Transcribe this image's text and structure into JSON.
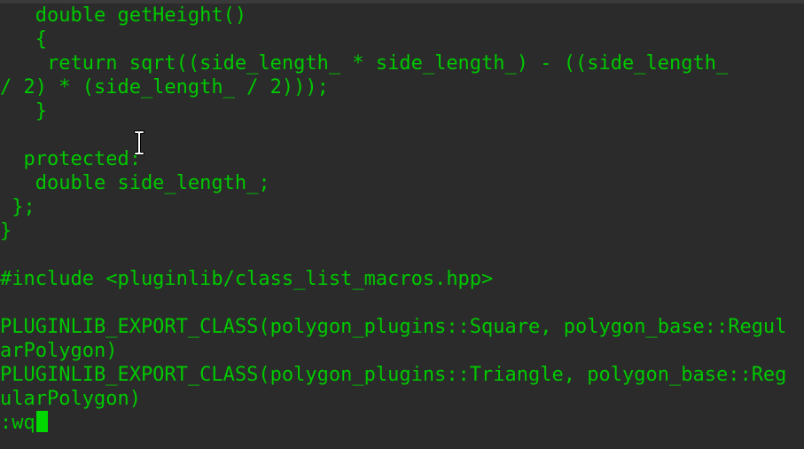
{
  "editor": {
    "lines": [
      "   double getHeight()",
      "   {",
      "    return sqrt((side_length_ * side_length_) - ((side_length_",
      "/ 2) * (side_length_ / 2)));",
      "   }",
      "",
      "  protected:",
      "   double side_length_;",
      " };",
      "}",
      "",
      "#include <pluginlib/class_list_macros.hpp>",
      "",
      "PLUGINLIB_EXPORT_CLASS(polygon_plugins::Square, polygon_base::Regul",
      "arPolygon)",
      "PLUGINLIB_EXPORT_CLASS(polygon_plugins::Triangle, polygon_base::Reg",
      "ularPolygon)"
    ],
    "command_line": ":wq",
    "text_color": "#00c800",
    "background_color": "#2b2b2b"
  }
}
